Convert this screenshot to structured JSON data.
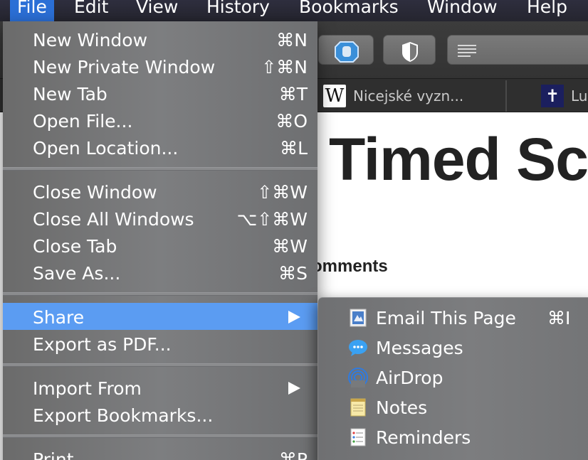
{
  "menubar": {
    "items": [
      "File",
      "Edit",
      "View",
      "History",
      "Bookmarks",
      "Window",
      "Help"
    ]
  },
  "tabs": [
    {
      "label": "Nicejské vyzn...",
      "icon": "wikipedia-icon"
    },
    {
      "label": "Lu",
      "icon": "cross-icon"
    }
  ],
  "page": {
    "heading": "Timed Scr",
    "comments": "omments"
  },
  "file_menu": {
    "items": [
      {
        "label": "New Window",
        "shortcut": "⌘N"
      },
      {
        "label": "New Private Window",
        "shortcut": "⇧⌘N"
      },
      {
        "label": "New Tab",
        "shortcut": "⌘T"
      },
      {
        "label": "Open File...",
        "shortcut": "⌘O"
      },
      {
        "label": "Open Location...",
        "shortcut": "⌘L"
      },
      {
        "label": "Close Window",
        "shortcut": "⇧⌘W"
      },
      {
        "label": "Close All Windows",
        "shortcut": "⌥⇧⌘W"
      },
      {
        "label": "Close Tab",
        "shortcut": "⌘W"
      },
      {
        "label": "Save As...",
        "shortcut": "⌘S"
      },
      {
        "label": "Share",
        "shortcut": ""
      },
      {
        "label": "Export as PDF...",
        "shortcut": ""
      },
      {
        "label": "Import From",
        "shortcut": ""
      },
      {
        "label": "Export Bookmarks...",
        "shortcut": ""
      },
      {
        "label": "Print",
        "shortcut": "⌘P"
      }
    ]
  },
  "share_menu": {
    "items": [
      {
        "label": "Email This Page",
        "shortcut": "⌘I",
        "icon": "mail-stamp-icon"
      },
      {
        "label": "Messages",
        "shortcut": "",
        "icon": "messages-icon"
      },
      {
        "label": "AirDrop",
        "shortcut": "",
        "icon": "airdrop-icon"
      },
      {
        "label": "Notes",
        "shortcut": "",
        "icon": "notes-icon"
      },
      {
        "label": "Reminders",
        "shortcut": "",
        "icon": "reminders-icon"
      }
    ]
  },
  "colors": {
    "menu_highlight": "#5b9cf2",
    "menubar_active": "#2b6fd6"
  }
}
